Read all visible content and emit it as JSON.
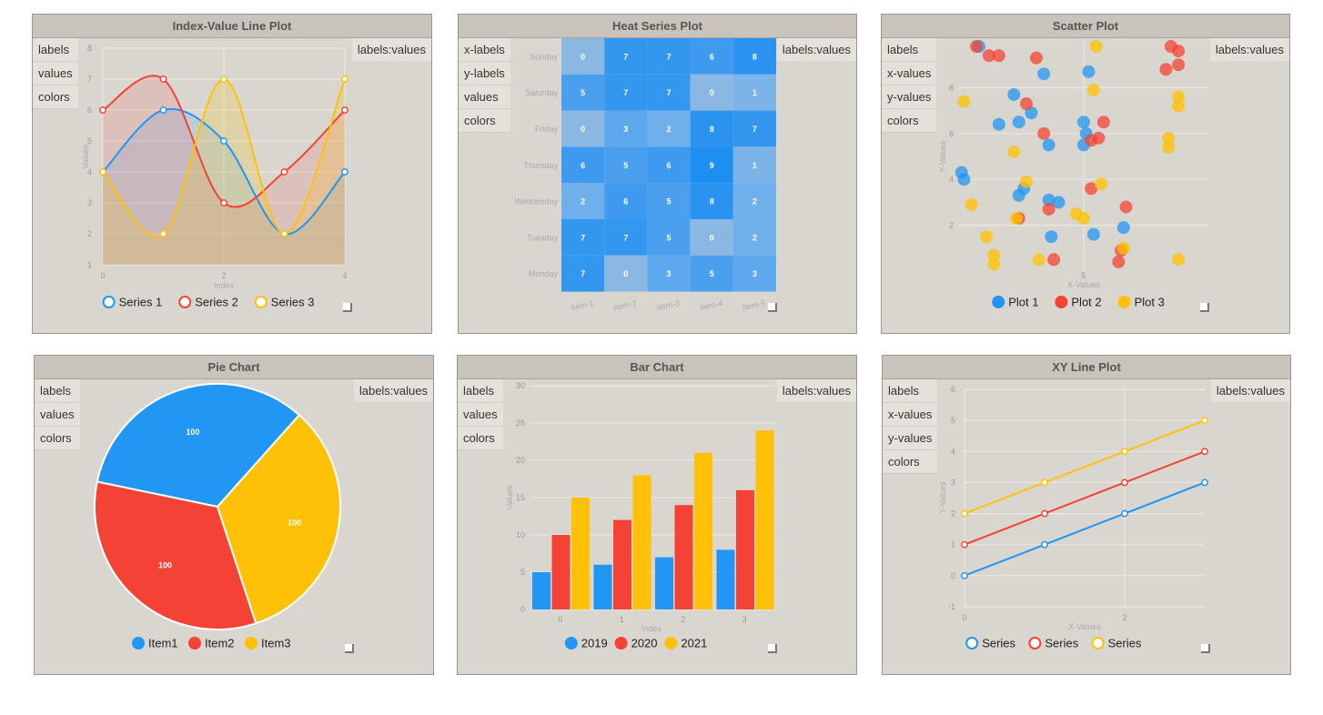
{
  "colors": {
    "blue": "#2196f3",
    "red": "#f44336",
    "yellow": "#ffc107"
  },
  "panels": {
    "line": {
      "title": "Index-Value Line Plot",
      "buttons": [
        "labels",
        "values",
        "colors"
      ],
      "rbtn": "labels:values"
    },
    "heat": {
      "title": "Heat Series Plot",
      "buttons": [
        "x-labels",
        "y-labels",
        "values",
        "colors"
      ],
      "rbtn": "labels:values"
    },
    "scatter": {
      "title": "Scatter Plot",
      "buttons": [
        "labels",
        "x-values",
        "y-values",
        "colors"
      ],
      "rbtn": "labels:values"
    },
    "pie": {
      "title": "Pie Chart",
      "buttons": [
        "labels",
        "values",
        "colors"
      ],
      "rbtn": "labels:values"
    },
    "bar": {
      "title": "Bar Chart",
      "buttons": [
        "labels",
        "values",
        "colors"
      ],
      "rbtn": "labels:values"
    },
    "xy": {
      "title": "XY Line Plot",
      "buttons": [
        "labels",
        "x-values",
        "y-values",
        "colors"
      ],
      "rbtn": "labels:values"
    }
  },
  "chart_data": [
    {
      "id": "line",
      "type": "line",
      "title": "Index-Value Line Plot",
      "xlabel": "Index",
      "ylabel": "Values",
      "x": [
        0,
        1,
        2,
        3,
        4
      ],
      "xticks": [
        0,
        2,
        4
      ],
      "ylim": [
        1,
        8
      ],
      "yticks": [
        1,
        2,
        3,
        4,
        5,
        6,
        7,
        8
      ],
      "series": [
        {
          "name": "Series 1",
          "values": [
            4,
            6,
            5,
            2,
            4
          ]
        },
        {
          "name": "Series 2",
          "values": [
            6,
            7,
            3,
            4,
            6
          ]
        },
        {
          "name": "Series 3",
          "values": [
            4,
            2,
            7,
            2,
            7
          ]
        }
      ]
    },
    {
      "id": "heat",
      "type": "heatmap",
      "title": "Heat Series Plot",
      "x_labels": [
        "Item-1",
        "Item-2",
        "Item-3",
        "Item-4",
        "Item-5"
      ],
      "y_labels": [
        "Sunday",
        "Saturday",
        "Friday",
        "Thursday",
        "Wednesday",
        "Tuesday",
        "Monday"
      ],
      "values": [
        [
          0,
          7,
          7,
          6,
          8
        ],
        [
          5,
          7,
          7,
          0,
          1
        ],
        [
          0,
          3,
          2,
          8,
          7
        ],
        [
          6,
          5,
          6,
          9,
          1
        ],
        [
          2,
          6,
          5,
          8,
          2
        ],
        [
          7,
          7,
          5,
          0,
          2
        ],
        [
          7,
          0,
          3,
          5,
          3
        ]
      ]
    },
    {
      "id": "scatter",
      "type": "scatter",
      "title": "Scatter Plot",
      "xlabel": "X-Values",
      "ylabel": "Y-Values",
      "xlim": [
        0,
        10
      ],
      "xticks": [
        5
      ],
      "ylim": [
        0,
        10
      ],
      "yticks": [
        2,
        4,
        6,
        8
      ],
      "series": [
        {
          "name": "Plot 1",
          "points": [
            [
              0.1,
              4.3
            ],
            [
              0.2,
              4.0
            ],
            [
              1.6,
              6.4
            ],
            [
              2.2,
              7.7
            ],
            [
              2.4,
              6.5
            ],
            [
              2.6,
              3.6
            ],
            [
              2.4,
              3.3
            ],
            [
              2.9,
              6.9
            ],
            [
              3.4,
              8.6
            ],
            [
              3.6,
              5.5
            ],
            [
              3.6,
              3.1
            ],
            [
              3.7,
              1.5
            ],
            [
              4.0,
              3.0
            ],
            [
              5.0,
              5.5
            ],
            [
              5.0,
              6.5
            ],
            [
              5.1,
              6.0
            ],
            [
              5.2,
              8.7
            ],
            [
              5.4,
              1.6
            ],
            [
              6.6,
              1.9
            ],
            [
              0.8,
              9.8
            ]
          ]
        },
        {
          "name": "Plot 2",
          "points": [
            [
              0.7,
              9.8
            ],
            [
              1.2,
              9.4
            ],
            [
              1.6,
              9.4
            ],
            [
              2.4,
              2.3
            ],
            [
              2.7,
              7.3
            ],
            [
              3.1,
              9.3
            ],
            [
              3.4,
              6.0
            ],
            [
              3.6,
              2.7
            ],
            [
              3.8,
              0.5
            ],
            [
              5.3,
              5.7
            ],
            [
              5.6,
              5.8
            ],
            [
              5.8,
              6.5
            ],
            [
              5.3,
              3.6
            ],
            [
              6.4,
              0.4
            ],
            [
              6.5,
              0.9
            ],
            [
              6.7,
              2.8
            ],
            [
              8.3,
              8.8
            ],
            [
              8.5,
              9.8
            ],
            [
              8.8,
              9.6
            ],
            [
              8.8,
              9.0
            ]
          ]
        },
        {
          "name": "Plot 3",
          "points": [
            [
              0.2,
              7.4
            ],
            [
              0.5,
              2.9
            ],
            [
              1.1,
              1.5
            ],
            [
              1.4,
              0.7
            ],
            [
              1.4,
              0.3
            ],
            [
              2.2,
              5.2
            ],
            [
              2.3,
              2.3
            ],
            [
              2.7,
              3.9
            ],
            [
              3.2,
              0.5
            ],
            [
              4.7,
              2.5
            ],
            [
              5.0,
              2.3
            ],
            [
              5.4,
              7.9
            ],
            [
              5.5,
              9.8
            ],
            [
              5.7,
              3.8
            ],
            [
              6.6,
              1.0
            ],
            [
              8.4,
              5.8
            ],
            [
              8.4,
              5.4
            ],
            [
              8.8,
              7.2
            ],
            [
              8.8,
              7.6
            ],
            [
              8.8,
              0.5
            ]
          ]
        }
      ]
    },
    {
      "id": "pie",
      "type": "pie",
      "title": "Pie Chart",
      "slices": [
        {
          "label": "Item1",
          "value": 100
        },
        {
          "label": "Item2",
          "value": 100
        },
        {
          "label": "Item3",
          "value": 100
        }
      ]
    },
    {
      "id": "bar",
      "type": "bar",
      "title": "Bar Chart",
      "xlabel": "Index",
      "ylabel": "Values",
      "categories": [
        "0",
        "1",
        "2",
        "3"
      ],
      "ylim": [
        0,
        30
      ],
      "yticks": [
        0,
        5,
        10,
        15,
        20,
        25,
        30
      ],
      "series": [
        {
          "name": "2019",
          "values": [
            5,
            6,
            7,
            8
          ]
        },
        {
          "name": "2020",
          "values": [
            10,
            12,
            14,
            16
          ]
        },
        {
          "name": "2021",
          "values": [
            15,
            18,
            21,
            24
          ]
        }
      ]
    },
    {
      "id": "xy",
      "type": "line",
      "title": "XY Line Plot",
      "xlabel": "X-Values",
      "ylabel": "Y-Values",
      "xlim": [
        0,
        3
      ],
      "xticks": [
        0,
        2
      ],
      "ylim": [
        -1,
        6
      ],
      "yticks": [
        -1,
        0,
        1,
        2,
        3,
        4,
        5,
        6
      ],
      "series": [
        {
          "name": "Series",
          "x": [
            0,
            1,
            2,
            3
          ],
          "values": [
            0,
            1,
            2,
            3
          ]
        },
        {
          "name": "Series",
          "x": [
            0,
            1,
            2,
            3
          ],
          "values": [
            1,
            2,
            3,
            4
          ]
        },
        {
          "name": "Series",
          "x": [
            0,
            1,
            2,
            3
          ],
          "values": [
            2,
            3,
            4,
            5
          ]
        }
      ]
    }
  ]
}
